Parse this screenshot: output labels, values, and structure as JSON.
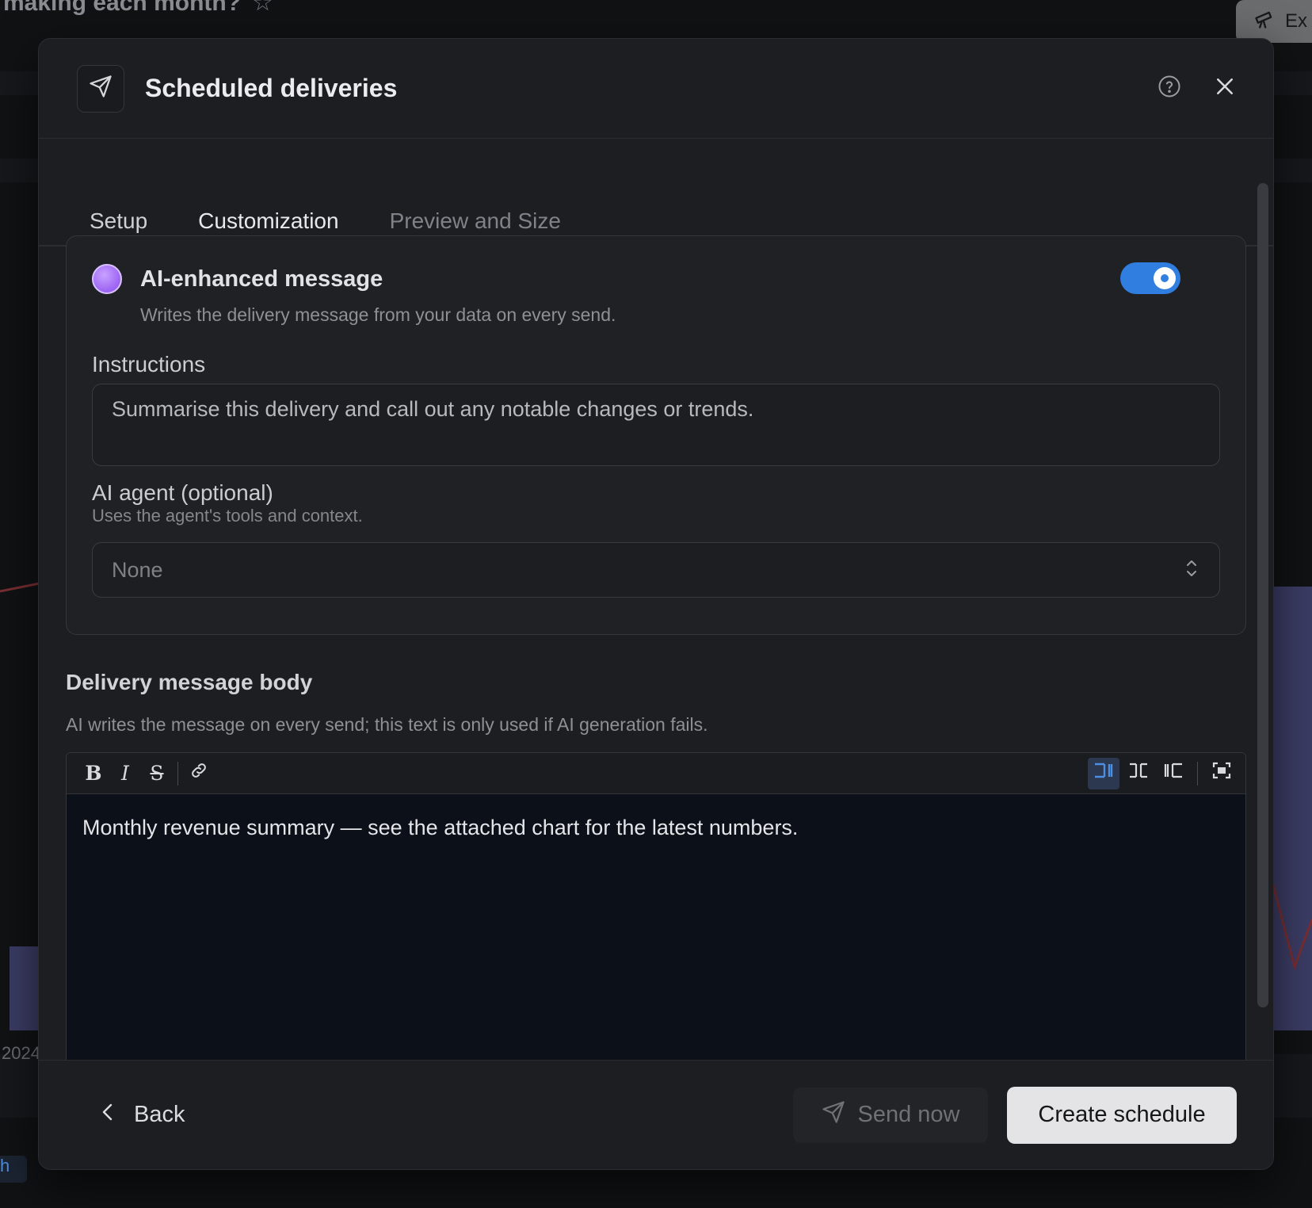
{
  "background": {
    "page_title": "making each month?",
    "explore_label": "Ex",
    "axis_year": "2024",
    "chip_label": "h"
  },
  "modal": {
    "title": "Scheduled deliveries",
    "tabs": [
      {
        "label": "Setup",
        "state": "default"
      },
      {
        "label": "Customization",
        "state": "active"
      },
      {
        "label": "Preview and Size",
        "state": "muted"
      }
    ]
  },
  "ai_section": {
    "title": "AI-enhanced message",
    "subtitle": "Writes the delivery message from your data on every send.",
    "enabled": true,
    "instructions_label": "Instructions",
    "instructions_value": "Summarise this delivery and call out any notable changes or trends.",
    "agent_label": "AI agent (optional)",
    "agent_help": "Uses the agent's tools and context.",
    "agent_value": "None"
  },
  "body_section": {
    "label": "Delivery message body",
    "help": "AI writes the message on every send; this text is only used if AI generation fails.",
    "content": "Monthly revenue summary — see the attached chart for the latest numbers.",
    "toolbar": {
      "bold": "B",
      "italic": "I",
      "strike": "S"
    }
  },
  "footer": {
    "back_label": "Back",
    "send_label": "Send now",
    "create_label": "Create schedule"
  },
  "colors": {
    "accent": "#3d86e6",
    "ai_purple": "#9c63f3",
    "surface": "#1d1e21",
    "editor_bg": "#0c1018"
  }
}
